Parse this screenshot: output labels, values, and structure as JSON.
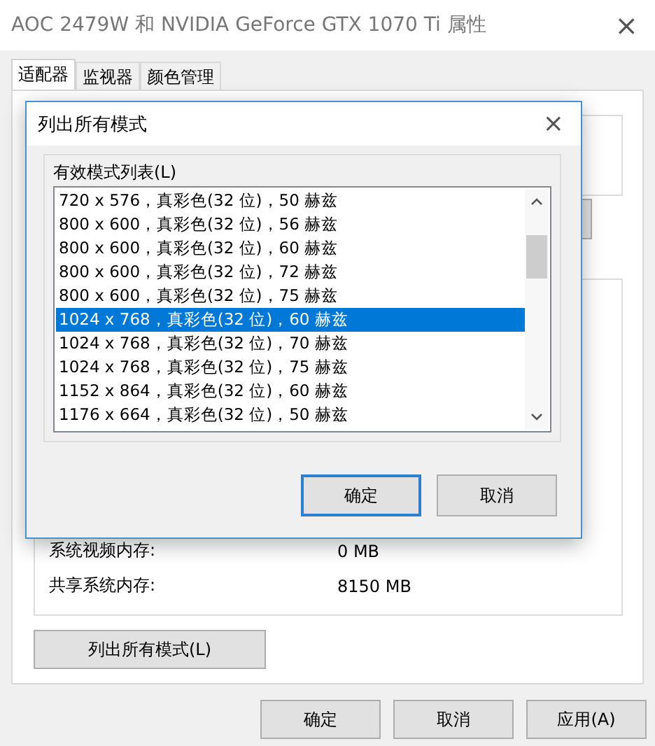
{
  "window": {
    "title": "AOC 2479W 和 NVIDIA GeForce GTX 1070 Ti 属性",
    "close": "×"
  },
  "tabs": [
    {
      "label": "适配器",
      "selected": true
    },
    {
      "label": "监视器",
      "selected": false
    },
    {
      "label": "颜色管理",
      "selected": false
    }
  ],
  "memory_rows": [
    {
      "label": "系统视频内存:",
      "value": "0 MB"
    },
    {
      "label": "共享系统内存:",
      "value": "8150 MB"
    }
  ],
  "list_modes_button": "列出所有模式(L)",
  "buttons": [
    {
      "label": "确定",
      "default": false
    },
    {
      "label": "取消",
      "default": false
    },
    {
      "label": "应用(A)",
      "default": false
    }
  ],
  "dialog": {
    "title": "列出所有模式",
    "close": "×",
    "group_label": "有效模式列表(L)",
    "modes": [
      {
        "label": "720 x 576，真彩色(32 位)，50 赫兹",
        "selected": false
      },
      {
        "label": "800 x 600，真彩色(32 位)，56 赫兹",
        "selected": false
      },
      {
        "label": "800 x 600，真彩色(32 位)，60 赫兹",
        "selected": false
      },
      {
        "label": "800 x 600，真彩色(32 位)，72 赫兹",
        "selected": false
      },
      {
        "label": "800 x 600，真彩色(32 位)，75 赫兹",
        "selected": false
      },
      {
        "label": "1024 x 768，真彩色(32 位)，60 赫兹",
        "selected": true
      },
      {
        "label": "1024 x 768，真彩色(32 位)，70 赫兹",
        "selected": false
      },
      {
        "label": "1024 x 768，真彩色(32 位)，75 赫兹",
        "selected": false
      },
      {
        "label": "1152 x 864，真彩色(32 位)，60 赫兹",
        "selected": false
      },
      {
        "label": "1176 x 664，真彩色(32 位)，50 赫兹",
        "selected": false
      }
    ],
    "buttons": [
      {
        "label": "确定",
        "default": true
      },
      {
        "label": "取消",
        "default": false
      }
    ]
  }
}
